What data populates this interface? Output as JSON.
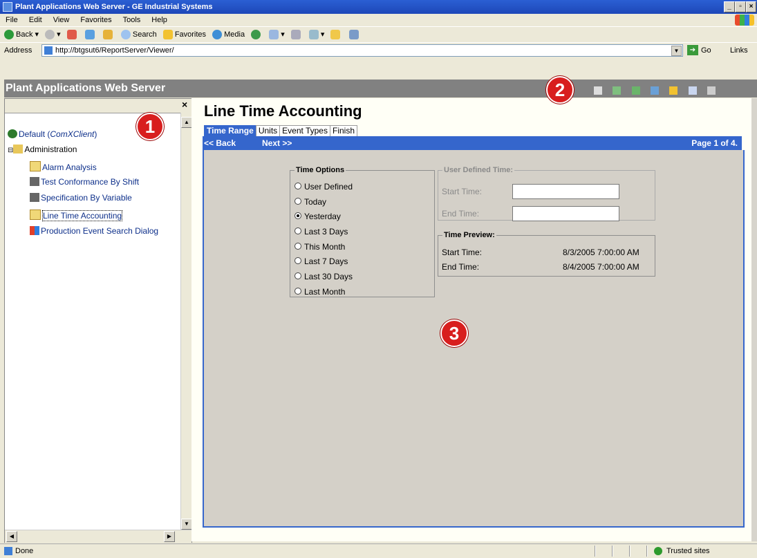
{
  "window": {
    "title": "Plant Applications Web Server - GE Industrial Systems"
  },
  "menu": [
    "File",
    "Edit",
    "View",
    "Favorites",
    "Tools",
    "Help"
  ],
  "toolbar": {
    "back": "Back",
    "search": "Search",
    "favorites": "Favorites",
    "media": "Media"
  },
  "address": {
    "label": "Address",
    "url": "http://btgsut6/ReportServer/Viewer/",
    "go": "Go",
    "links": "Links"
  },
  "app": {
    "title": "Plant Applications Web Server"
  },
  "sidebar": {
    "close": "×",
    "root": {
      "prefix": "Default (",
      "client": "ComXClient",
      "suffix": ")"
    },
    "folder": "Administration",
    "items": [
      {
        "label": "Alarm Analysis"
      },
      {
        "label": "Test Conformance By Shift"
      },
      {
        "label": "Specification By Variable"
      },
      {
        "label": "Line Time Accounting"
      },
      {
        "label": "Production Event Search Dialog"
      }
    ]
  },
  "main": {
    "title": "Line Time Accounting",
    "tabs": [
      "Time Range",
      "Units",
      "Event Types",
      "Finish"
    ],
    "back": "<< Back",
    "next": "Next >>",
    "page": "Page 1 of 4."
  },
  "time_options": {
    "legend": "Time Options",
    "options": [
      "User Defined",
      "Today",
      "Yesterday",
      "Last 3 Days",
      "This Month",
      "Last 7 Days",
      "Last 30 Days",
      "Last Month"
    ],
    "selected": "Yesterday"
  },
  "user_defined": {
    "legend": "User Defined Time:",
    "start_label": "Start Time:",
    "end_label": "End Time:",
    "start_value": "",
    "end_value": ""
  },
  "preview": {
    "legend": "Time Preview:",
    "start_label": "Start Time:",
    "end_label": "End Time:",
    "start_value": "8/3/2005 7:00:00 AM",
    "end_value": "8/4/2005 7:00:00 AM"
  },
  "markers": [
    "1",
    "2",
    "3"
  ],
  "status": {
    "left": "Done",
    "zone": "Trusted sites"
  },
  "colors": {
    "accent": "#3566cc",
    "header": "#818181",
    "marker": "#d81e1e",
    "titlebar": "#2b5fd3"
  }
}
